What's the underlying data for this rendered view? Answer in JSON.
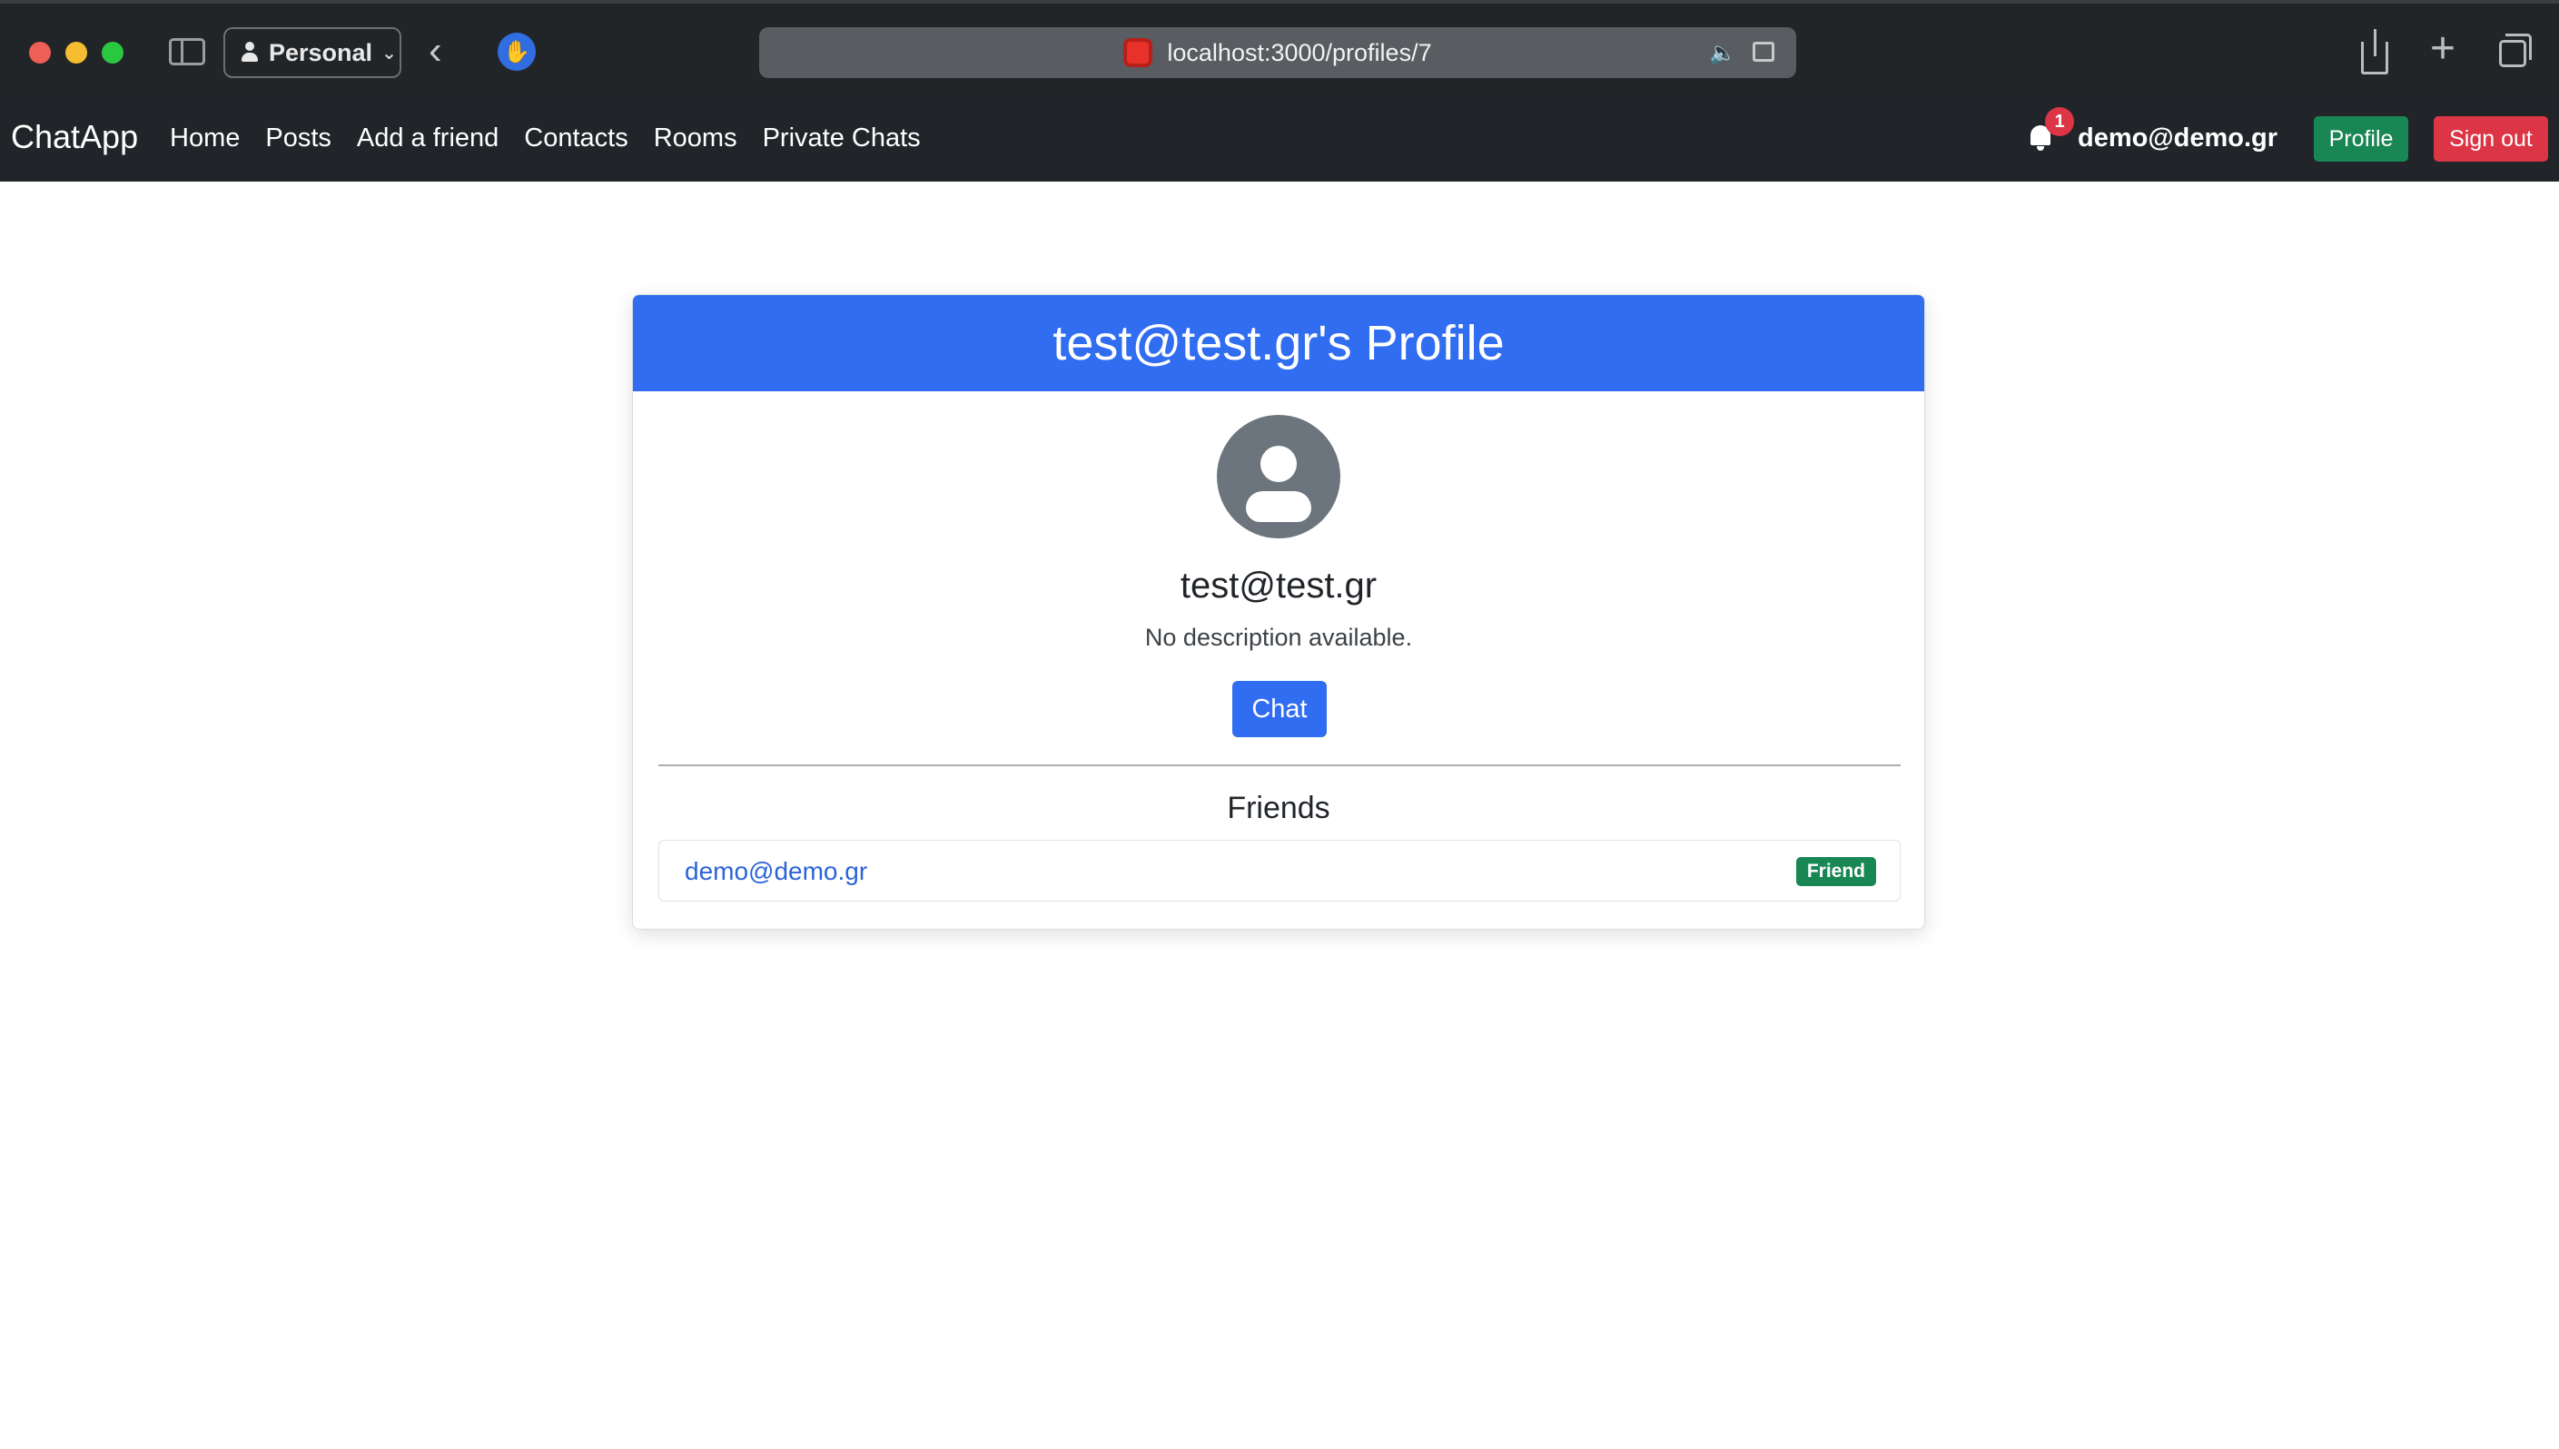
{
  "browser": {
    "profile_label": "Personal",
    "url": "localhost:3000/profiles/7",
    "icons": [
      "sidebar-icon",
      "person-icon",
      "chevron-down-icon",
      "back-arrow-icon",
      "hand-icon",
      "audio-icon",
      "reader-icon",
      "share-icon",
      "plus-icon",
      "tabs-icon"
    ]
  },
  "navbar": {
    "brand": "ChatApp",
    "links": [
      "Home",
      "Posts",
      "Add a friend",
      "Contacts",
      "Rooms",
      "Private Chats"
    ],
    "notification_count": "1",
    "user_email": "demo@demo.gr",
    "profile_button": "Profile",
    "signout_button": "Sign out"
  },
  "profile": {
    "header_title": "test@test.gr's Profile",
    "name": "test@test.gr",
    "description": "No description available.",
    "chat_button": "Chat",
    "friends_title": "Friends",
    "friends": [
      {
        "email": "demo@demo.gr",
        "badge": "Friend"
      }
    ]
  },
  "colors": {
    "navbar_bg": "#212529",
    "primary": "#306df0",
    "success": "#198754",
    "danger": "#dc3545",
    "avatar": "#6c757d"
  }
}
